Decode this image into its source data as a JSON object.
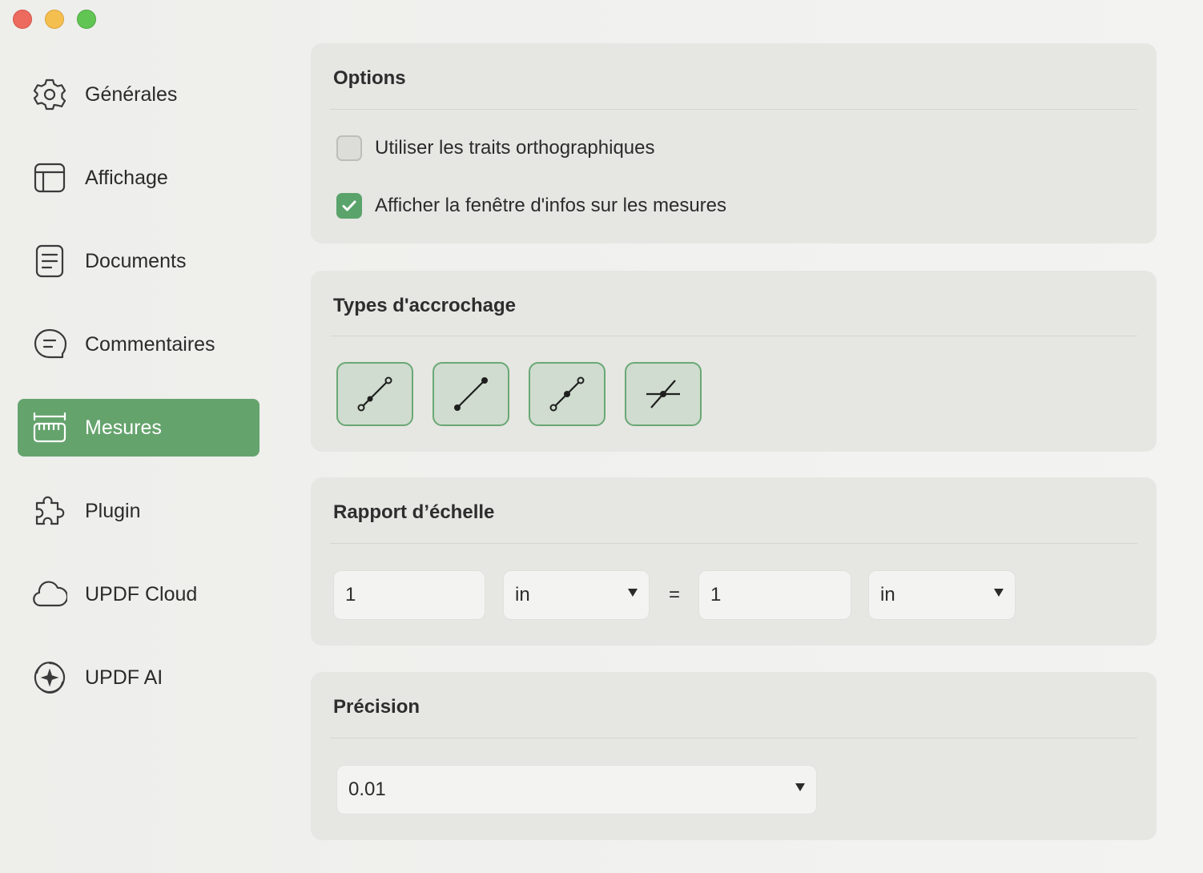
{
  "sidebar": {
    "items": [
      {
        "label": "Générales",
        "icon": "gear-icon",
        "active": false
      },
      {
        "label": "Affichage",
        "icon": "layout-icon",
        "active": false
      },
      {
        "label": "Documents",
        "icon": "document-icon",
        "active": false
      },
      {
        "label": "Commentaires",
        "icon": "comment-icon",
        "active": false
      },
      {
        "label": "Mesures",
        "icon": "ruler-icon",
        "active": true
      },
      {
        "label": "Plugin",
        "icon": "puzzle-icon",
        "active": false
      },
      {
        "label": "UPDF Cloud",
        "icon": "cloud-icon",
        "active": false
      },
      {
        "label": "UPDF AI",
        "icon": "ai-sparkle-icon",
        "active": false
      }
    ]
  },
  "options": {
    "title": "Options",
    "orthographic": {
      "label": "Utiliser les traits orthographiques",
      "checked": false
    },
    "show_info": {
      "label": "Afficher la fenêtre d'infos sur les mesures",
      "checked": true
    }
  },
  "snap": {
    "title": "Types d'accrochage",
    "buttons": [
      "snap-to-path-icon",
      "snap-to-endpoint-icon",
      "snap-to-midpoint-icon",
      "snap-to-intersection-icon"
    ]
  },
  "scale": {
    "title": "Rapport d’échelle",
    "left_value": "1",
    "left_unit": "in",
    "equals": "=",
    "right_value": "1",
    "right_unit": "in"
  },
  "precision": {
    "title": "Précision",
    "value": "0.01"
  },
  "colors": {
    "accent": "#65a36d",
    "panel_bg": "#e6e6e3"
  }
}
